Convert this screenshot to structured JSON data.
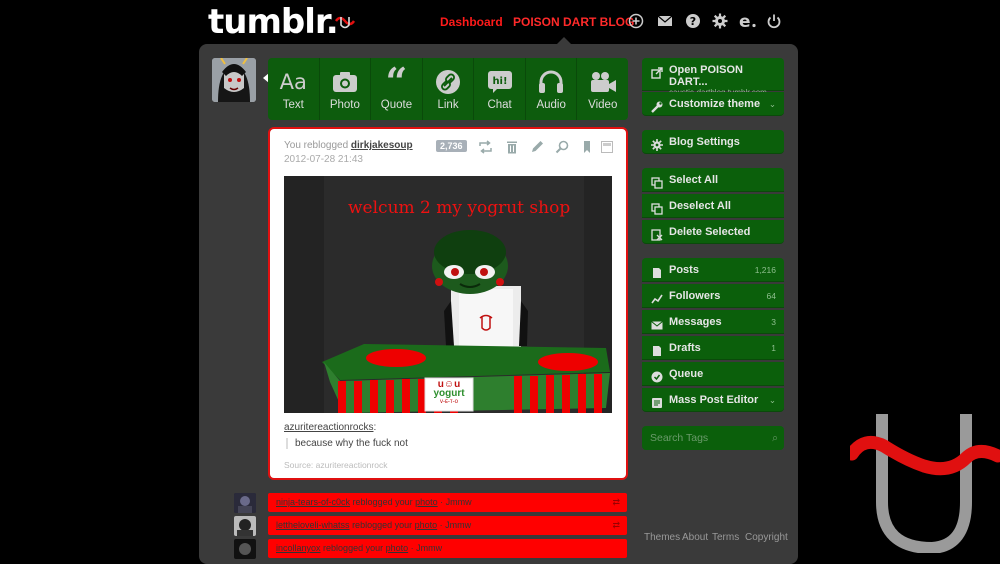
{
  "header": {
    "logo": "tumblr.",
    "nav": {
      "dashboard": "Dashboard",
      "blog": "POISON DART BLOG"
    },
    "icons": [
      "plus-circle-icon",
      "mail-icon",
      "help-icon",
      "gear-icon",
      "edit-icon",
      "power-icon"
    ]
  },
  "post_types": [
    {
      "label": "Text",
      "icon": "text-icon"
    },
    {
      "label": "Photo",
      "icon": "camera-icon"
    },
    {
      "label": "Quote",
      "icon": "quote-icon"
    },
    {
      "label": "Link",
      "icon": "link-icon"
    },
    {
      "label": "Chat",
      "icon": "chat-icon"
    },
    {
      "label": "Audio",
      "icon": "headphones-icon"
    },
    {
      "label": "Video",
      "icon": "video-icon"
    }
  ],
  "post": {
    "reblog_prefix": "You reblogged",
    "reblog_user": "dirkjakesoup",
    "date": "2012-07-28 21:43",
    "notes": "2,736",
    "image_caption": "welcum 2 my yogrut shop",
    "sign_line1": "u☺u",
    "sign_line2": "yogurt",
    "sign_line3": "ᴠ-ᴇ-ᴛ-ᴏ",
    "quote_source_user": "azuritereactionrocks",
    "quote_colon": ":",
    "quote_text": "because why the fuck not",
    "source": "Source: azuritereactionrock"
  },
  "notes_rows": [
    {
      "user": "ninja-tears-of-c0ck",
      "action": "reblogged your",
      "link": "photo",
      "via": "· Jmmw"
    },
    {
      "user": "lettheloveli-whatss",
      "action": "reblogged your",
      "link": "photo",
      "via": "· Jmmw"
    },
    {
      "user": "incollanyox",
      "action": "reblogged your",
      "link": "photo",
      "via": "· Jmmw"
    }
  ],
  "sidebar": {
    "open_blog": "Open POISON DART...",
    "open_blog_url": "caustic-dartblog.tumblr.com",
    "customize": "Customize theme",
    "blog_settings": "Blog Settings",
    "select_all": "Select All",
    "deselect_all": "Deselect All",
    "delete_selected": "Delete Selected",
    "posts": "Posts",
    "posts_count": "1,216",
    "followers": "Followers",
    "followers_count": "64",
    "messages": "Messages",
    "messages_count": "3",
    "drafts": "Drafts",
    "drafts_count": "1",
    "queue": "Queue",
    "mass_post_editor": "Mass Post Editor",
    "search_placeholder": "Search Tags"
  },
  "footer": {
    "themes": "Themes",
    "about": "About",
    "terms": "Terms",
    "copyright": "Copyright"
  },
  "colors": {
    "accent_red": "#ff0000",
    "sidebar_green": "#0b5f0b",
    "panel": "#3a3a3a"
  }
}
